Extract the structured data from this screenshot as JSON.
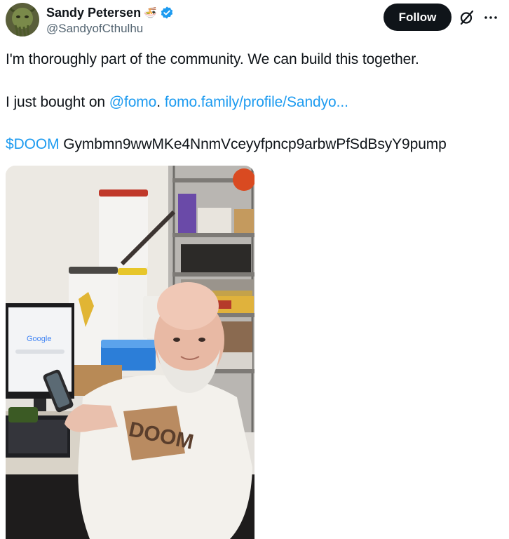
{
  "user": {
    "name": "Sandy Petersen",
    "badge_emoji": "🍜",
    "handle": "@SandyofCthulhu",
    "verified": true
  },
  "follow_label": "Follow",
  "post": {
    "line1": "I'm thoroughly part of the community. We can build this together.",
    "line2_prefix": "I just bought on ",
    "line2_mention": "@fomo",
    "line2_sep": ". ",
    "line2_link": "fomo.family/profile/Sandyo...",
    "line3_cashtag": "$DOOM",
    "line3_text": " Gymbmn9wwMKe4NnmVceyyfpncp9arbwPfSdBsyY9pump"
  },
  "media": {
    "monitor_text": "Google",
    "shirt_text": "DOOM"
  },
  "colors": {
    "link": "#1d9bf0",
    "verified": "#1d9bf0",
    "follow_bg": "#0f1419",
    "secondary_text": "#536471"
  },
  "icons": [
    "grok-icon",
    "more-icon",
    "verified-icon"
  ]
}
